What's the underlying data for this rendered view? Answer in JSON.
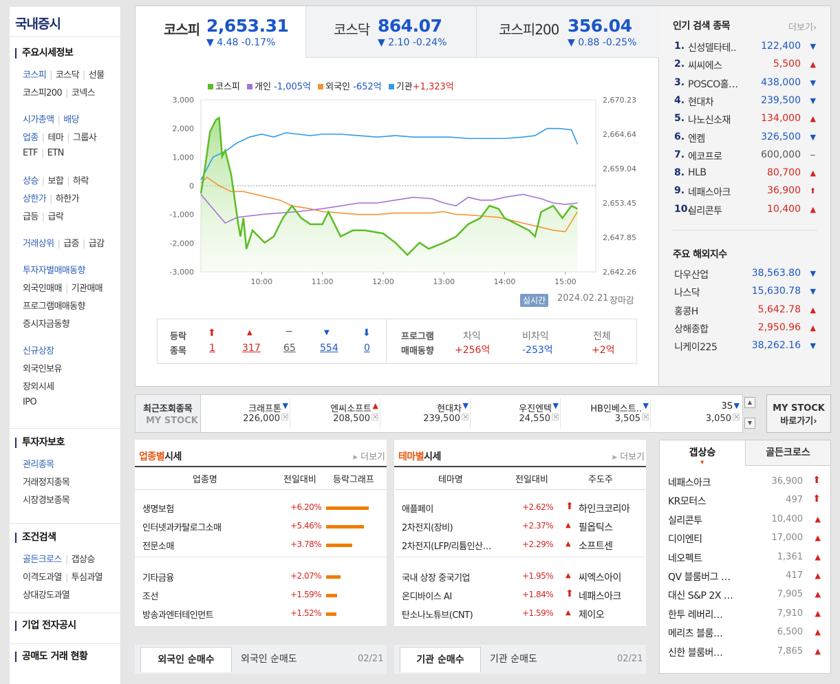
{
  "sidebar": {
    "title": "국내증시",
    "sections": [
      {
        "header": "주요시세정보"
      },
      {
        "header": "투자자보호"
      },
      {
        "header": "조건검색"
      },
      {
        "header": "기업 전자공시"
      },
      {
        "header": "공매도 거래 현황"
      }
    ],
    "links": {
      "kospi": "코스피",
      "kosdaq": "코스닥",
      "futures": "선물",
      "kospi200": "코스피200",
      "konex": "코넥스",
      "market_cap": "시가총액",
      "dividend": "배당",
      "industry": "업종",
      "theme": "테마",
      "group": "그룹사",
      "etf": "ETF",
      "etn": "ETN",
      "rise": "상승",
      "flat": "보합",
      "fall": "하락",
      "upper": "상한가",
      "lower": "하한가",
      "surge": "급등",
      "plunge": "급락",
      "volume_top": "거래상위",
      "vol_surge": "급증",
      "vol_drop": "급감",
      "investor_trend": "투자자별매매동향",
      "foreign_trade": "외국인매매",
      "inst_trade": "기관매매",
      "program_trend": "프로그램매매동향",
      "deposit_trend": "증시자금동향",
      "new_listing": "신규상장",
      "foreign_holding": "외국인보유",
      "otc": "장외시세",
      "ipo": "IPO",
      "managed": "관리종목",
      "suspended": "거래정지종목",
      "warning": "시장경보종목",
      "golden_cross": "골든크로스",
      "gap_up": "갭상승",
      "disparity": "이격도과열",
      "psych": "투심과열",
      "rsi": "상대강도과열"
    }
  },
  "indices": [
    {
      "name": "코스피",
      "value": "2,653.31",
      "change": "▼ 4.48 -0.17%"
    },
    {
      "name": "코스닥",
      "value": "864.07",
      "change": "▼ 2.10 -0.24%"
    },
    {
      "name": "코스피200",
      "value": "356.04",
      "change": "▼ 0.88 -0.25%"
    }
  ],
  "legend": {
    "kospi": "코스피",
    "individual_label": "개인",
    "individual_value": "-1,005억",
    "foreign_label": "외국인",
    "foreign_value": "-652억",
    "institution_label": "기관",
    "institution_value": "+1,323억"
  },
  "colors": {
    "kospi": "#5cbd25",
    "individual": "#a374d6",
    "foreign": "#f39433",
    "institution": "#2f9be8",
    "down": "#1a56c8",
    "up": "#d6241d"
  },
  "chart_data": {
    "type": "line",
    "x_ticks": [
      "10:00",
      "11:00",
      "12:00",
      "13:00",
      "14:00",
      "15:00"
    ],
    "y_left_ticks": [
      "3,000",
      "2,000",
      "1,000",
      "0",
      "-1,000",
      "-2,000",
      "-3,000"
    ],
    "y_right_ticks": [
      "2,670.23",
      "2,664.64",
      "2,659.04",
      "2,653.45",
      "2,647.85",
      "2,642.26"
    ],
    "ylim_left": [
      -3000,
      3000
    ],
    "ylim_right": [
      2642.26,
      2670.23
    ],
    "x_range": [
      "09:00",
      "15:30"
    ],
    "series": [
      {
        "name": "코스피",
        "axis": "right",
        "points": [
          [
            0,
            2655
          ],
          [
            0.05,
            2658
          ],
          [
            0.15,
            2665
          ],
          [
            0.25,
            2667
          ],
          [
            0.3,
            2667.3
          ],
          [
            0.35,
            2661
          ],
          [
            0.4,
            2662
          ],
          [
            0.5,
            2658
          ],
          [
            0.6,
            2651
          ],
          [
            0.65,
            2648
          ],
          [
            0.7,
            2651
          ],
          [
            0.75,
            2646
          ],
          [
            0.85,
            2649
          ],
          [
            0.95,
            2648
          ],
          [
            1.05,
            2647
          ],
          [
            1.2,
            2648
          ],
          [
            1.35,
            2651
          ],
          [
            1.5,
            2653
          ],
          [
            1.65,
            2651
          ],
          [
            1.8,
            2650
          ],
          [
            2.0,
            2650
          ],
          [
            2.1,
            2652
          ],
          [
            2.3,
            2648
          ],
          [
            2.5,
            2649
          ],
          [
            2.7,
            2649
          ],
          [
            3.0,
            2648.5
          ],
          [
            3.2,
            2647
          ],
          [
            3.4,
            2645
          ],
          [
            3.6,
            2647
          ],
          [
            3.75,
            2646
          ],
          [
            4.0,
            2647
          ],
          [
            4.2,
            2648
          ],
          [
            4.4,
            2650
          ],
          [
            4.6,
            2651
          ],
          [
            4.75,
            2653
          ],
          [
            4.9,
            2652.5
          ],
          [
            5.0,
            2651
          ],
          [
            5.2,
            2650
          ],
          [
            5.4,
            2649
          ],
          [
            5.5,
            2648
          ],
          [
            5.6,
            2652
          ],
          [
            5.8,
            2653
          ],
          [
            5.95,
            2651
          ],
          [
            6.1,
            2653
          ],
          [
            6.2,
            2652.5
          ]
        ]
      },
      {
        "name": "개인",
        "axis": "left",
        "points": [
          [
            0,
            -300
          ],
          [
            0.2,
            -800
          ],
          [
            0.4,
            -1300
          ],
          [
            0.6,
            -1100
          ],
          [
            0.8,
            -1050
          ],
          [
            1.0,
            -1000
          ],
          [
            1.3,
            -950
          ],
          [
            1.6,
            -900
          ],
          [
            2.0,
            -800
          ],
          [
            2.3,
            -700
          ],
          [
            2.6,
            -600
          ],
          [
            2.9,
            -600
          ],
          [
            3.2,
            -500
          ],
          [
            3.5,
            -400
          ],
          [
            3.8,
            -450
          ],
          [
            4.0,
            -600
          ],
          [
            4.2,
            -700
          ],
          [
            4.4,
            -400
          ],
          [
            4.6,
            -500
          ],
          [
            4.8,
            -500
          ],
          [
            5.0,
            -400
          ],
          [
            5.3,
            -300
          ],
          [
            5.6,
            -450
          ],
          [
            5.8,
            -600
          ],
          [
            6.0,
            -650
          ],
          [
            6.2,
            -600
          ]
        ]
      },
      {
        "name": "외국인",
        "axis": "left",
        "points": [
          [
            0,
            100
          ],
          [
            0.1,
            300
          ],
          [
            0.2,
            150
          ],
          [
            0.3,
            0
          ],
          [
            0.5,
            -200
          ],
          [
            0.7,
            -200
          ],
          [
            0.9,
            -300
          ],
          [
            1.1,
            -400
          ],
          [
            1.3,
            -500
          ],
          [
            1.5,
            -700
          ],
          [
            1.8,
            -800
          ],
          [
            2.0,
            -900
          ],
          [
            2.3,
            -950
          ],
          [
            2.6,
            -1000
          ],
          [
            2.9,
            -1000
          ],
          [
            3.2,
            -950
          ],
          [
            3.5,
            -950
          ],
          [
            3.8,
            -950
          ],
          [
            4.0,
            -900
          ],
          [
            4.2,
            -1000
          ],
          [
            4.3,
            -1000
          ],
          [
            4.6,
            -1050
          ],
          [
            4.9,
            -1100
          ],
          [
            5.2,
            -1250
          ],
          [
            5.5,
            -1400
          ],
          [
            5.8,
            -1550
          ],
          [
            6.0,
            -1600
          ],
          [
            6.2,
            -900
          ]
        ]
      },
      {
        "name": "기관",
        "axis": "left",
        "points": [
          [
            0,
            200
          ],
          [
            0.2,
            1000
          ],
          [
            0.4,
            1200
          ],
          [
            0.6,
            1500
          ],
          [
            0.8,
            1700
          ],
          [
            1.0,
            1800
          ],
          [
            1.2,
            1700
          ],
          [
            1.4,
            1850
          ],
          [
            1.6,
            1800
          ],
          [
            1.8,
            1750
          ],
          [
            2.0,
            1800
          ],
          [
            2.3,
            1800
          ],
          [
            2.6,
            1750
          ],
          [
            2.9,
            1700
          ],
          [
            3.2,
            1750
          ],
          [
            3.5,
            1700
          ],
          [
            3.8,
            1700
          ],
          [
            4.1,
            1700
          ],
          [
            4.4,
            1650
          ],
          [
            4.7,
            1650
          ],
          [
            5.0,
            1650
          ],
          [
            5.3,
            1700
          ],
          [
            5.5,
            1750
          ],
          [
            5.7,
            2000
          ],
          [
            5.9,
            2000
          ],
          [
            6.1,
            1950
          ],
          [
            6.2,
            1450
          ]
        ]
      }
    ]
  },
  "chart_footer": {
    "realtime": "실시간",
    "date": "2024.02.21",
    "status": "장마감"
  },
  "updown": {
    "label1": "등락",
    "label2": "종목",
    "upper": "1",
    "up": "317",
    "flat": "65",
    "down": "554",
    "lower": "0",
    "program_label1": "프로그램",
    "program_label2": "매매동향",
    "arb_label": "차익",
    "arb": "+256억",
    "nonarb_label": "비차익",
    "nonarb": "-253억",
    "total_label": "전체",
    "total": "+2억"
  },
  "popular": {
    "title": "인기 검색 종목",
    "more": "더보기",
    "items": [
      {
        "rank": "1.",
        "name": "신성델타테..",
        "value": "122,400",
        "dir": "down"
      },
      {
        "rank": "2.",
        "name": "씨씨에스",
        "value": "5,500",
        "dir": "up"
      },
      {
        "rank": "3.",
        "name": "POSCO홀…",
        "value": "438,000",
        "dir": "down"
      },
      {
        "rank": "4.",
        "name": "현대차",
        "value": "239,500",
        "dir": "down"
      },
      {
        "rank": "5.",
        "name": "나노신소재",
        "value": "134,000",
        "dir": "up"
      },
      {
        "rank": "6.",
        "name": "엔켐",
        "value": "326,500",
        "dir": "down"
      },
      {
        "rank": "7.",
        "name": "에코프로",
        "value": "600,000",
        "dir": "flat"
      },
      {
        "rank": "8.",
        "name": "HLB",
        "value": "80,700",
        "dir": "up"
      },
      {
        "rank": "9.",
        "name": "네패스아크",
        "value": "36,900",
        "dir": "upper"
      },
      {
        "rank": "10.",
        "name": "실리콘투",
        "value": "10,400",
        "dir": "up"
      }
    ]
  },
  "overseas": {
    "title": "주요 해외지수",
    "items": [
      {
        "name": "다우산업",
        "value": "38,563.80",
        "dir": "down"
      },
      {
        "name": "나스닥",
        "value": "15,630.78",
        "dir": "down"
      },
      {
        "name": "홍콩H",
        "value": "5,642.78",
        "dir": "up"
      },
      {
        "name": "상해종합",
        "value": "2,950.96",
        "dir": "up"
      },
      {
        "name": "니케이225",
        "value": "38,262.16",
        "dir": "down"
      }
    ]
  },
  "mystock": {
    "label1": "최근조회종목",
    "label2": "MY STOCK",
    "items": [
      {
        "name": "크래프톤",
        "price": "226,000",
        "dir": "down"
      },
      {
        "name": "엔씨소프트",
        "price": "208,500",
        "dir": "up"
      },
      {
        "name": "현대차",
        "price": "239,500",
        "dir": "down"
      },
      {
        "name": "우진엔텍",
        "price": "24,550",
        "dir": "down"
      },
      {
        "name": "HB인베스트..",
        "price": "3,505",
        "dir": "down"
      },
      {
        "name": "3S",
        "price": "3,050",
        "dir": "down"
      }
    ],
    "btn_line1": "MY STOCK",
    "btn_line2": "바로가기"
  },
  "industry": {
    "title_a": "업종별",
    "title_b": "시세",
    "more": "더보기",
    "h_name": "업종명",
    "h_change": "전일대비",
    "h_graph": "등락그래프",
    "rows": [
      {
        "name": "생명보험",
        "change": "+6.20%",
        "pct": 6.2
      },
      {
        "name": "인터넷과카탈로그소매",
        "change": "+5.46%",
        "pct": 5.46
      },
      {
        "name": "전문소매",
        "change": "+3.78%",
        "pct": 3.78
      },
      {
        "name": "기타금융",
        "change": "+2.07%",
        "pct": 2.07
      },
      {
        "name": "조선",
        "change": "+1.59%",
        "pct": 1.59
      },
      {
        "name": "방송과엔터테인먼트",
        "change": "+1.52%",
        "pct": 1.52
      }
    ]
  },
  "theme": {
    "title_a": "테마별",
    "title_b": "시세",
    "more": "더보기",
    "h_name": "테마명",
    "h_change": "전일대비",
    "h_leader": "주도주",
    "rows": [
      {
        "name": "애플페이",
        "change": "+2.62%",
        "leader": "하인크코리아",
        "dir": "upper"
      },
      {
        "name": "2차전지(장비)",
        "change": "+2.37%",
        "leader": "필옵틱스",
        "dir": "up"
      },
      {
        "name": "2차전지(LFP/리튬인산…",
        "change": "+2.29%",
        "leader": "소프트센",
        "dir": "up"
      },
      {
        "name": "국내 상장 중국기업",
        "change": "+1.95%",
        "leader": "씨엑스아이",
        "dir": "up"
      },
      {
        "name": "온디바이스 AI",
        "change": "+1.84%",
        "leader": "네패스아크",
        "dir": "upper"
      },
      {
        "name": "탄소나노튜브(CNT)",
        "change": "+1.59%",
        "leader": "제이오",
        "dir": "up"
      }
    ]
  },
  "gap": {
    "tab1": "갭상승",
    "tab2": "골든크로스",
    "rows": [
      {
        "name": "네패스아크",
        "value": "36,900",
        "dir": "upper"
      },
      {
        "name": "KR모터스",
        "value": "497",
        "dir": "upper"
      },
      {
        "name": "실리콘투",
        "value": "10,400",
        "dir": "up"
      },
      {
        "name": "디이엔티",
        "value": "17,000",
        "dir": "up"
      },
      {
        "name": "네오펙트",
        "value": "1,361",
        "dir": "up"
      },
      {
        "name": "QV 블룸버그 …",
        "value": "417",
        "dir": "up"
      },
      {
        "name": "대신 S&P 2X …",
        "value": "7,905",
        "dir": "up"
      },
      {
        "name": "한투 레버리…",
        "value": "7,910",
        "dir": "up"
      },
      {
        "name": "메리츠 블룸…",
        "value": "6,500",
        "dir": "up"
      },
      {
        "name": "신한 블룸버…",
        "value": "7,865",
        "dir": "up"
      }
    ]
  },
  "bottom_tabs": {
    "foreign_buy": "외국인 순매수",
    "foreign_sell": "외국인 순매도",
    "date1": "02/21",
    "inst_buy": "기관 순매수",
    "inst_sell": "기관 순매도",
    "date2": "02/21"
  }
}
